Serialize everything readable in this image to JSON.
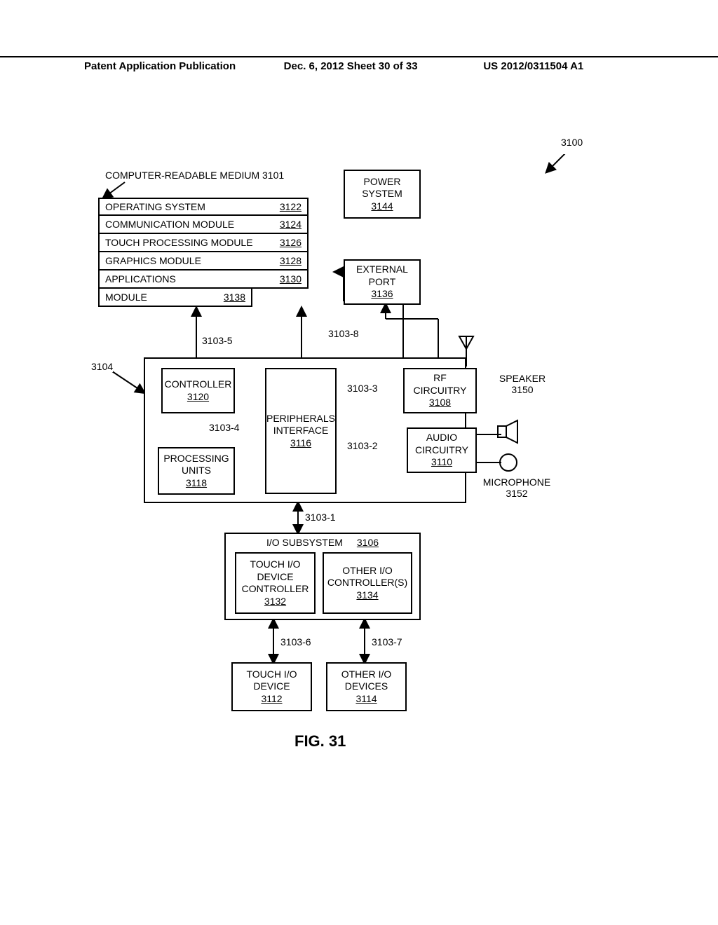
{
  "header": {
    "left": "Patent Application Publication",
    "mid": "Dec. 6, 2012   Sheet 30 of 33",
    "right": "US 2012/0311504 A1"
  },
  "figure_label": "FIG. 31",
  "refs": {
    "system": "3100",
    "medium_title": "COMPUTER-READABLE MEDIUM 3101",
    "os_row": "OPERATING SYSTEM",
    "os_ref": "3122",
    "comm_row": "COMMUNICATION MODULE",
    "comm_ref": "3124",
    "touchproc_row": "TOUCH PROCESSING MODULE",
    "touchproc_ref": "3126",
    "graphics_row": "GRAPHICS MODULE",
    "graphics_ref": "3128",
    "apps_row": "APPLICATIONS",
    "apps_ref": "3130",
    "module_row": "MODULE",
    "module_ref": "3138",
    "power": "POWER SYSTEM",
    "power_ref": "3144",
    "extport": "EXTERNAL PORT",
    "extport_ref": "3136",
    "rf": "RF CIRCUITRY",
    "rf_ref": "3108",
    "audio": "AUDIO CIRCUITRY",
    "audio_ref": "3110",
    "speaker": "SPEAKER",
    "speaker_ref": "3150",
    "mic": "MICROPHONE",
    "mic_ref": "3152",
    "controller": "CONTROLLER",
    "controller_ref": "3120",
    "peripherals": "PERIPHERALS INTERFACE",
    "peripherals_ref": "3116",
    "processing": "PROCESSING UNITS",
    "processing_ref": "3118",
    "iosub": "I/O SUBSYSTEM",
    "iosub_ref": "3106",
    "touchctrl": "TOUCH I/O DEVICE CONTROLLER",
    "touchctrl_ref": "3132",
    "otherctrl": "OTHER I/O CONTROLLER(S)",
    "otherctrl_ref": "3134",
    "touchdev": "TOUCH I/O DEVICE",
    "touchdev_ref": "3112",
    "otherdev": "OTHER I/O DEVICES",
    "otherdev_ref": "3114",
    "b3103_1": "3103-1",
    "b3103_2": "3103-2",
    "b3103_3": "3103-3",
    "b3103_4": "3103-4",
    "b3103_5": "3103-5",
    "b3103_6": "3103-6",
    "b3103_7": "3103-7",
    "b3103_8": "3103-8",
    "b3104": "3104"
  }
}
